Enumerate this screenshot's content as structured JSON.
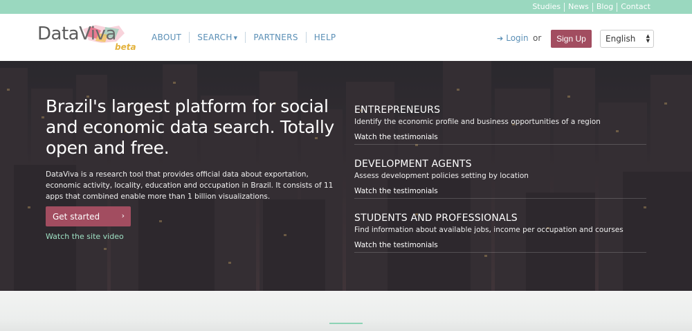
{
  "topbar": {
    "links": [
      "Studies",
      "News",
      "Blog",
      "Contact"
    ]
  },
  "header": {
    "logo_main": "Data",
    "logo_accent": "Viva",
    "logo_beta": "beta",
    "nav": [
      {
        "label": "ABOUT"
      },
      {
        "label": "SEARCH"
      },
      {
        "label": "PARTNERS"
      },
      {
        "label": "HELP"
      }
    ],
    "login_label": "Login",
    "or_text": "or",
    "signup_label": "Sign Up",
    "language": "English"
  },
  "hero": {
    "title": "Brazil's largest platform for social and economic data search. Totally open and free.",
    "description": "DataViva is a research tool that provides official data about exportation, economic activity, locality, education and occupation in Brazil. It consists of 11 apps that combined enable more than 1 billion visualizations.",
    "cta_label": "Get started",
    "video_link": "Watch the site video",
    "audiences": [
      {
        "heading": "ENTREPRENEURS",
        "description": "Identify the economic profile and business opportunities of a region",
        "link": "Watch the testimonials"
      },
      {
        "heading": "DEVELOPMENT AGENTS",
        "description": "Assess development policies setting by location",
        "link": "Watch the testimonials"
      },
      {
        "heading": "STUDENTS AND PROFESSIONALS",
        "description": "Find information about available jobs, income per occupation and courses",
        "link": "Watch the testimonials"
      }
    ]
  },
  "colors": {
    "topbar": "#9ad8bf",
    "brand_button": "#a24d60",
    "nav_link": "#5a8fb6",
    "hero_link": "#9ee0c3"
  },
  "icons": {
    "login": "sign-in-icon",
    "search_caret": "caret-down-icon",
    "cta_chevron": "chevron-right-icon",
    "select_arrows": "select-arrows-icon"
  }
}
